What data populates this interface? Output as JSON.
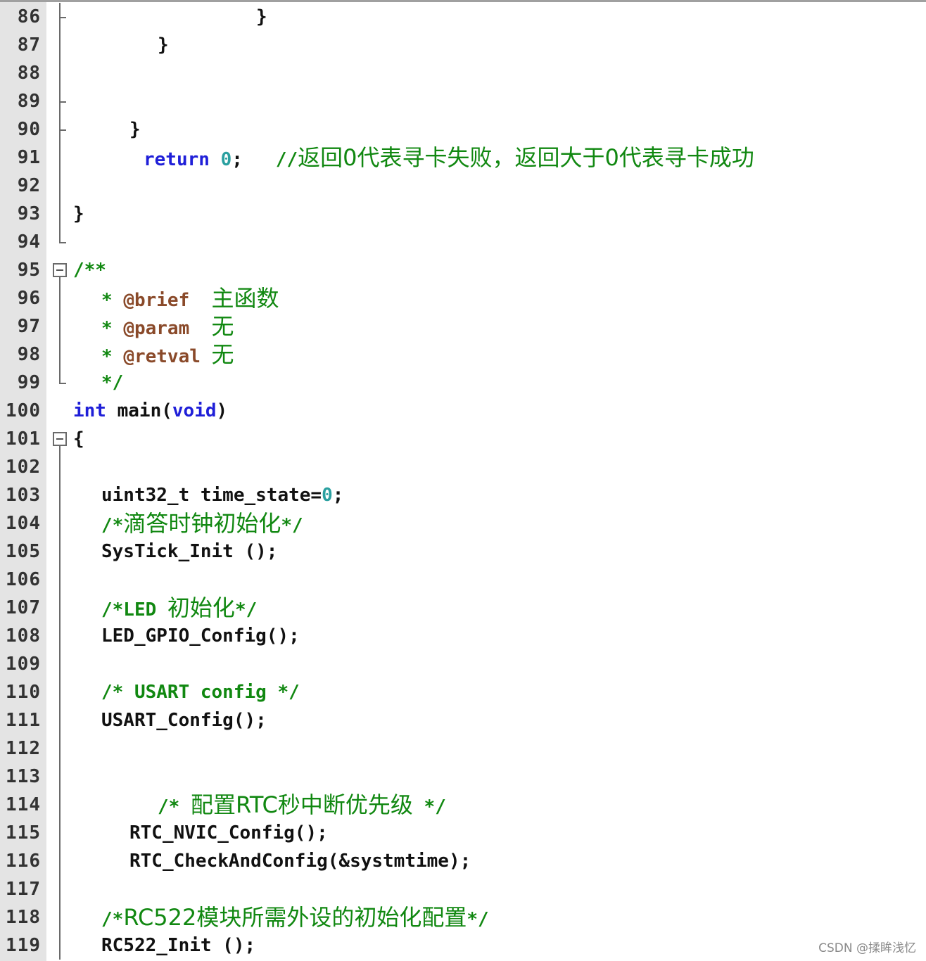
{
  "editor": {
    "lines": [
      {
        "n": "86",
        "indent": 260,
        "tokens": [
          {
            "t": "}",
            "c": "plain"
          }
        ]
      },
      {
        "n": "87",
        "indent": 120,
        "tokens": [
          {
            "t": "}",
            "c": "plain"
          }
        ]
      },
      {
        "n": "88",
        "indent": 0,
        "tokens": []
      },
      {
        "n": "89",
        "indent": 0,
        "tokens": []
      },
      {
        "n": "90",
        "indent": 80,
        "tokens": [
          {
            "t": "}",
            "c": "plain"
          }
        ]
      },
      {
        "n": "91",
        "indent": 100,
        "tokens": [
          {
            "t": "return ",
            "c": "kw"
          },
          {
            "t": "0",
            "c": "num"
          },
          {
            "t": ";   ",
            "c": "plain"
          },
          {
            "t": "//",
            "c": "comment"
          },
          {
            "t": "返回0代表寻卡失败，返回大于0代表寻卡成功",
            "c": "cjk"
          }
        ]
      },
      {
        "n": "92",
        "indent": 0,
        "tokens": []
      },
      {
        "n": "93",
        "indent": 0,
        "tokens": [
          {
            "t": "}",
            "c": "plain"
          }
        ]
      },
      {
        "n": "94",
        "indent": 0,
        "tokens": []
      },
      {
        "n": "95",
        "indent": 0,
        "tokens": [
          {
            "t": "/**",
            "c": "comment"
          }
        ]
      },
      {
        "n": "96",
        "indent": 40,
        "tokens": [
          {
            "t": "* ",
            "c": "comment"
          },
          {
            "t": "@brief  ",
            "c": "tag"
          },
          {
            "t": "主函数",
            "c": "cjk"
          }
        ]
      },
      {
        "n": "97",
        "indent": 40,
        "tokens": [
          {
            "t": "* ",
            "c": "comment"
          },
          {
            "t": "@param  ",
            "c": "tag"
          },
          {
            "t": "无",
            "c": "cjk"
          }
        ]
      },
      {
        "n": "98",
        "indent": 40,
        "tokens": [
          {
            "t": "* ",
            "c": "comment"
          },
          {
            "t": "@retval ",
            "c": "tag"
          },
          {
            "t": "无",
            "c": "cjk"
          }
        ]
      },
      {
        "n": "99",
        "indent": 40,
        "tokens": [
          {
            "t": "*/",
            "c": "comment"
          }
        ]
      },
      {
        "n": "100",
        "indent": 0,
        "tokens": [
          {
            "t": "int",
            "c": "kw"
          },
          {
            "t": " main(",
            "c": "plain"
          },
          {
            "t": "void",
            "c": "kw"
          },
          {
            "t": ")",
            "c": "plain"
          }
        ]
      },
      {
        "n": "101",
        "indent": 0,
        "tokens": [
          {
            "t": "{",
            "c": "plain"
          }
        ]
      },
      {
        "n": "102",
        "indent": 0,
        "tokens": []
      },
      {
        "n": "103",
        "indent": 40,
        "tokens": [
          {
            "t": "uint32_t time_state=",
            "c": "plain"
          },
          {
            "t": "0",
            "c": "num"
          },
          {
            "t": ";",
            "c": "plain"
          }
        ]
      },
      {
        "n": "104",
        "indent": 40,
        "tokens": [
          {
            "t": "/*",
            "c": "comment"
          },
          {
            "t": "滴答时钟初始化",
            "c": "cjk"
          },
          {
            "t": "*/",
            "c": "comment"
          }
        ]
      },
      {
        "n": "105",
        "indent": 40,
        "tokens": [
          {
            "t": "SysTick_Init ();",
            "c": "plain"
          }
        ]
      },
      {
        "n": "106",
        "indent": 0,
        "tokens": []
      },
      {
        "n": "107",
        "indent": 40,
        "tokens": [
          {
            "t": "/*LED ",
            "c": "comment"
          },
          {
            "t": "初始化",
            "c": "cjk"
          },
          {
            "t": "*/",
            "c": "comment"
          }
        ]
      },
      {
        "n": "108",
        "indent": 40,
        "tokens": [
          {
            "t": "LED_GPIO_Config();",
            "c": "plain"
          }
        ]
      },
      {
        "n": "109",
        "indent": 0,
        "tokens": []
      },
      {
        "n": "110",
        "indent": 40,
        "tokens": [
          {
            "t": "/* USART config */",
            "c": "comment"
          }
        ]
      },
      {
        "n": "111",
        "indent": 40,
        "tokens": [
          {
            "t": "USART_Config();",
            "c": "plain"
          }
        ]
      },
      {
        "n": "112",
        "indent": 0,
        "tokens": []
      },
      {
        "n": "113",
        "indent": 0,
        "tokens": []
      },
      {
        "n": "114",
        "indent": 120,
        "tokens": [
          {
            "t": "/* ",
            "c": "comment"
          },
          {
            "t": "配置RTC秒中断优先级",
            "c": "cjk"
          },
          {
            "t": " */",
            "c": "comment"
          }
        ]
      },
      {
        "n": "115",
        "indent": 80,
        "tokens": [
          {
            "t": "RTC_NVIC_Config();",
            "c": "plain"
          }
        ]
      },
      {
        "n": "116",
        "indent": 80,
        "tokens": [
          {
            "t": "RTC_CheckAndConfig(&systmtime);",
            "c": "plain"
          }
        ]
      },
      {
        "n": "117",
        "indent": 0,
        "tokens": []
      },
      {
        "n": "118",
        "indent": 40,
        "tokens": [
          {
            "t": "/*",
            "c": "comment"
          },
          {
            "t": "RC522模块所需外设的初始化配置",
            "c": "cjk"
          },
          {
            "t": "*/",
            "c": "comment"
          }
        ]
      },
      {
        "n": "119",
        "indent": 40,
        "tokens": [
          {
            "t": "RC522_Init ();",
            "c": "plain"
          }
        ]
      }
    ]
  },
  "colors": {
    "keyword": "#1f1fd8",
    "number": "#2aa0a0",
    "comment": "#118811",
    "doc_tag": "#8a4a2a",
    "gutter": "#e4e4e4"
  },
  "fold_markers": [
    "fold-end-line-86",
    "fold-end-line-89",
    "fold-end-line-90",
    "fold-end-line-94",
    "fold-collapse-box-95",
    "fold-end-line-99",
    "fold-collapse-box-101"
  ],
  "watermark": "CSDN @揉眸浅忆"
}
